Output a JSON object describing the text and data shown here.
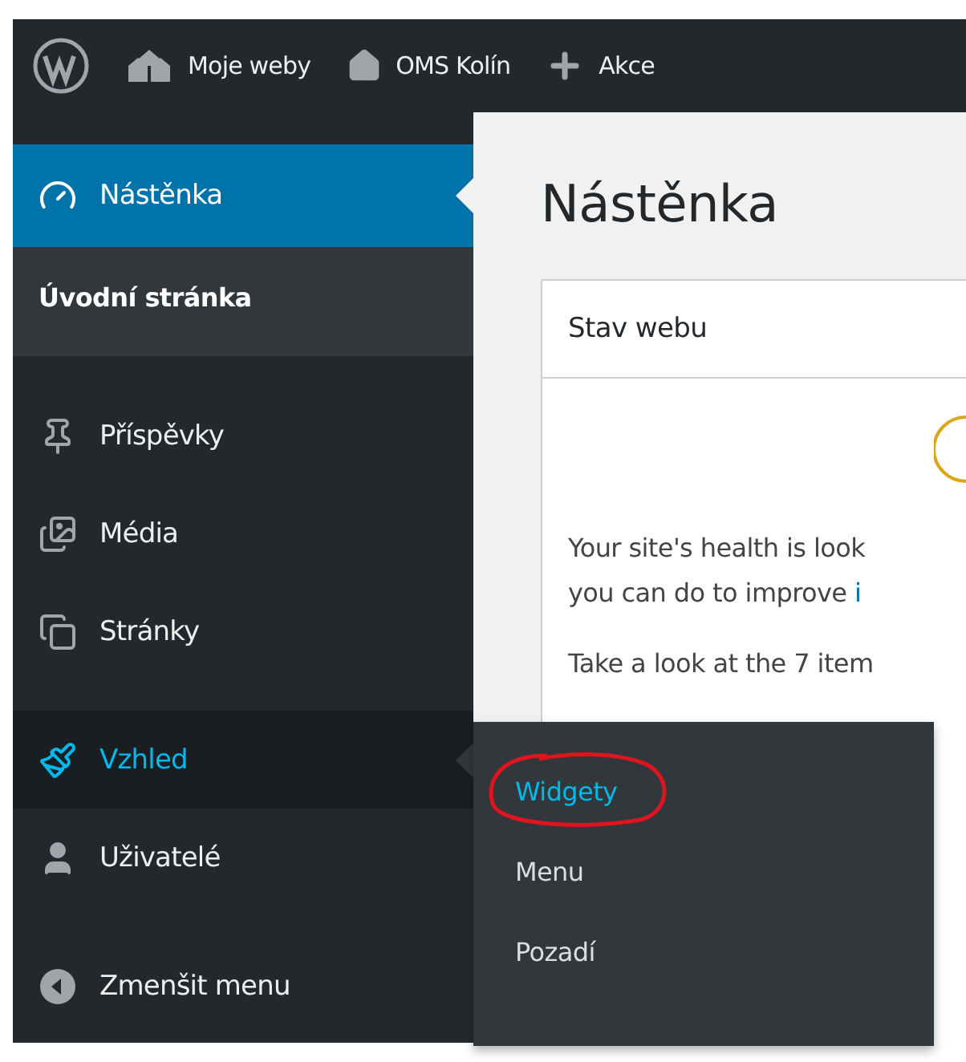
{
  "admin_bar": {
    "items": [
      {
        "kind": "logo"
      },
      {
        "kind": "sites",
        "label": "Moje weby"
      },
      {
        "kind": "home",
        "label": "OMS Kolín"
      },
      {
        "kind": "new",
        "label": "Akce"
      }
    ]
  },
  "sidebar": {
    "items": [
      {
        "kind": "dashboard",
        "label": "Nástěnka",
        "selected": true,
        "expanded": false,
        "children": [
          {
            "label": "Úvodní stránka",
            "selected": true
          }
        ]
      },
      {
        "kind": "separator"
      },
      {
        "kind": "posts",
        "label": "Příspěvky",
        "selected": false,
        "expanded": false
      },
      {
        "kind": "media",
        "label": "Média",
        "selected": false,
        "expanded": false
      },
      {
        "kind": "pages",
        "label": "Stránky",
        "selected": false,
        "expanded": false
      },
      {
        "kind": "separator"
      },
      {
        "kind": "appearance",
        "label": "Vzhled",
        "selected": false,
        "expanded": true,
        "children": [
          {
            "label": "Widgety",
            "selected": true,
            "circled": true
          },
          {
            "label": "Menu",
            "selected": false,
            "circled": false
          },
          {
            "label": "Pozadí",
            "selected": false,
            "circled": false
          }
        ]
      },
      {
        "kind": "users",
        "label": "Uživatelé",
        "selected": false,
        "expanded": false
      },
      {
        "kind": "separator"
      },
      {
        "kind": "collapse",
        "label": "Zmenšit menu",
        "selected": false,
        "expanded": false
      }
    ]
  },
  "content": {
    "title": "Nástěnka",
    "card": {
      "title": "Stav webu",
      "lines": [
        {
          "text": "Your site's health is look"
        },
        {
          "text": "you can do to improve ",
          "link": "i"
        }
      ],
      "footer": "Take a look at the 7 item"
    }
  }
}
